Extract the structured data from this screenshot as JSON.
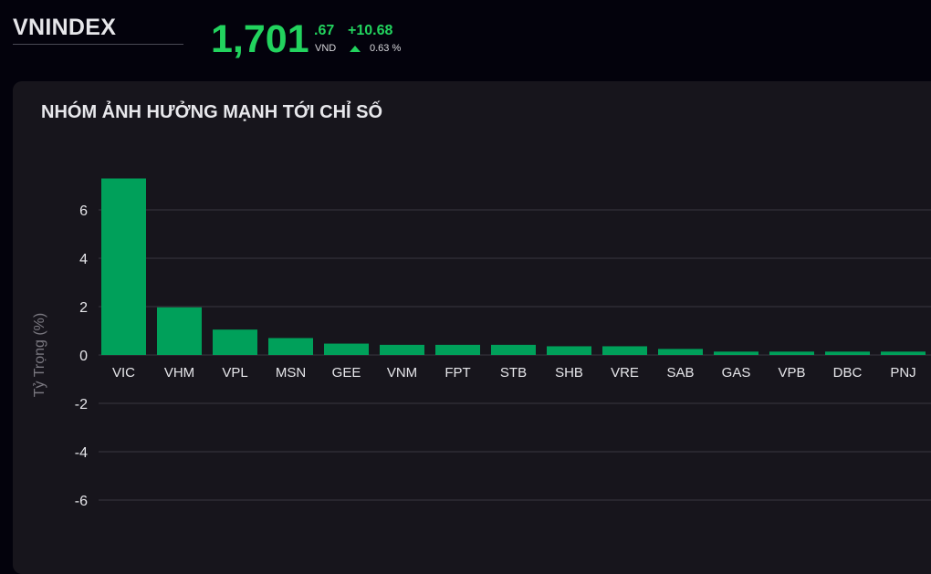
{
  "header": {
    "index_name": "VNINDEX",
    "price_integer": "1,701",
    "price_decimal": ".67",
    "currency": "VND",
    "change_abs": "+10.68",
    "change_pct": "0.63 %",
    "up_color": "#22d35e"
  },
  "chart_data": {
    "type": "bar",
    "title": "NHÓM ẢNH HƯỞNG MẠNH TỚI CHỈ SỐ",
    "ylabel": "Tỷ Trọng (%)",
    "xlabel": "",
    "ylim": [
      -7.5,
      7.5
    ],
    "yticks": [
      6,
      4,
      2,
      0,
      -2,
      -4,
      -6
    ],
    "ytick_labels": [
      "6",
      "4",
      "2",
      "0",
      "-2",
      "-4",
      "-6"
    ],
    "grid": true,
    "categories": [
      "VIC",
      "VHM",
      "VPL",
      "MSN",
      "GEE",
      "VNM",
      "FPT",
      "STB",
      "SHB",
      "VRE",
      "SAB",
      "GAS",
      "VPB",
      "DBC",
      "PNJ"
    ],
    "values": [
      7.3,
      1.97,
      1.05,
      0.7,
      0.47,
      0.42,
      0.42,
      0.42,
      0.36,
      0.36,
      0.25,
      0.14,
      0.14,
      0.14,
      0.14
    ],
    "bar_color": "#00a05a",
    "grid_color": "#3a3840",
    "label_color": "#e6e6ea",
    "ylabel_color": "#7a7880"
  }
}
